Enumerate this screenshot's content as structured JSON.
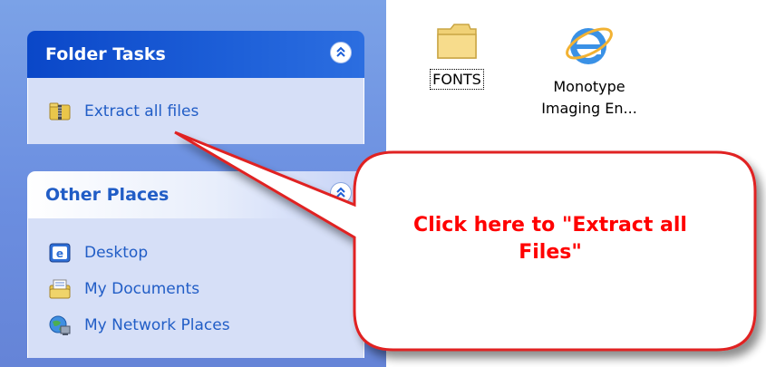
{
  "folder_tasks": {
    "title": "Folder Tasks",
    "collapse_icon": "chevron-up-icon",
    "items": [
      {
        "label": "Extract all files",
        "icon": "zip-folder-icon"
      }
    ]
  },
  "other_places": {
    "title": "Other Places",
    "collapse_icon": "chevron-up-icon",
    "items": [
      {
        "label": "Desktop",
        "icon": "desktop-icon"
      },
      {
        "label": "My Documents",
        "icon": "my-documents-icon"
      },
      {
        "label": "My Network Places",
        "icon": "network-places-icon"
      }
    ]
  },
  "files": [
    {
      "label": "FONTS",
      "icon": "folder-icon"
    },
    {
      "label_line1": "Monotype",
      "label_line2": "Imaging En...",
      "icon": "internet-explorer-icon"
    }
  ],
  "callout": {
    "line1": "Click here to \"Extract all",
    "line2": "Files\"",
    "color": "#ff0000"
  },
  "colors": {
    "pane_bg": "#7ba2e7",
    "header_blue": "#0a47c8",
    "link_blue": "#215dc6",
    "body_bg": "#d6dff7"
  }
}
